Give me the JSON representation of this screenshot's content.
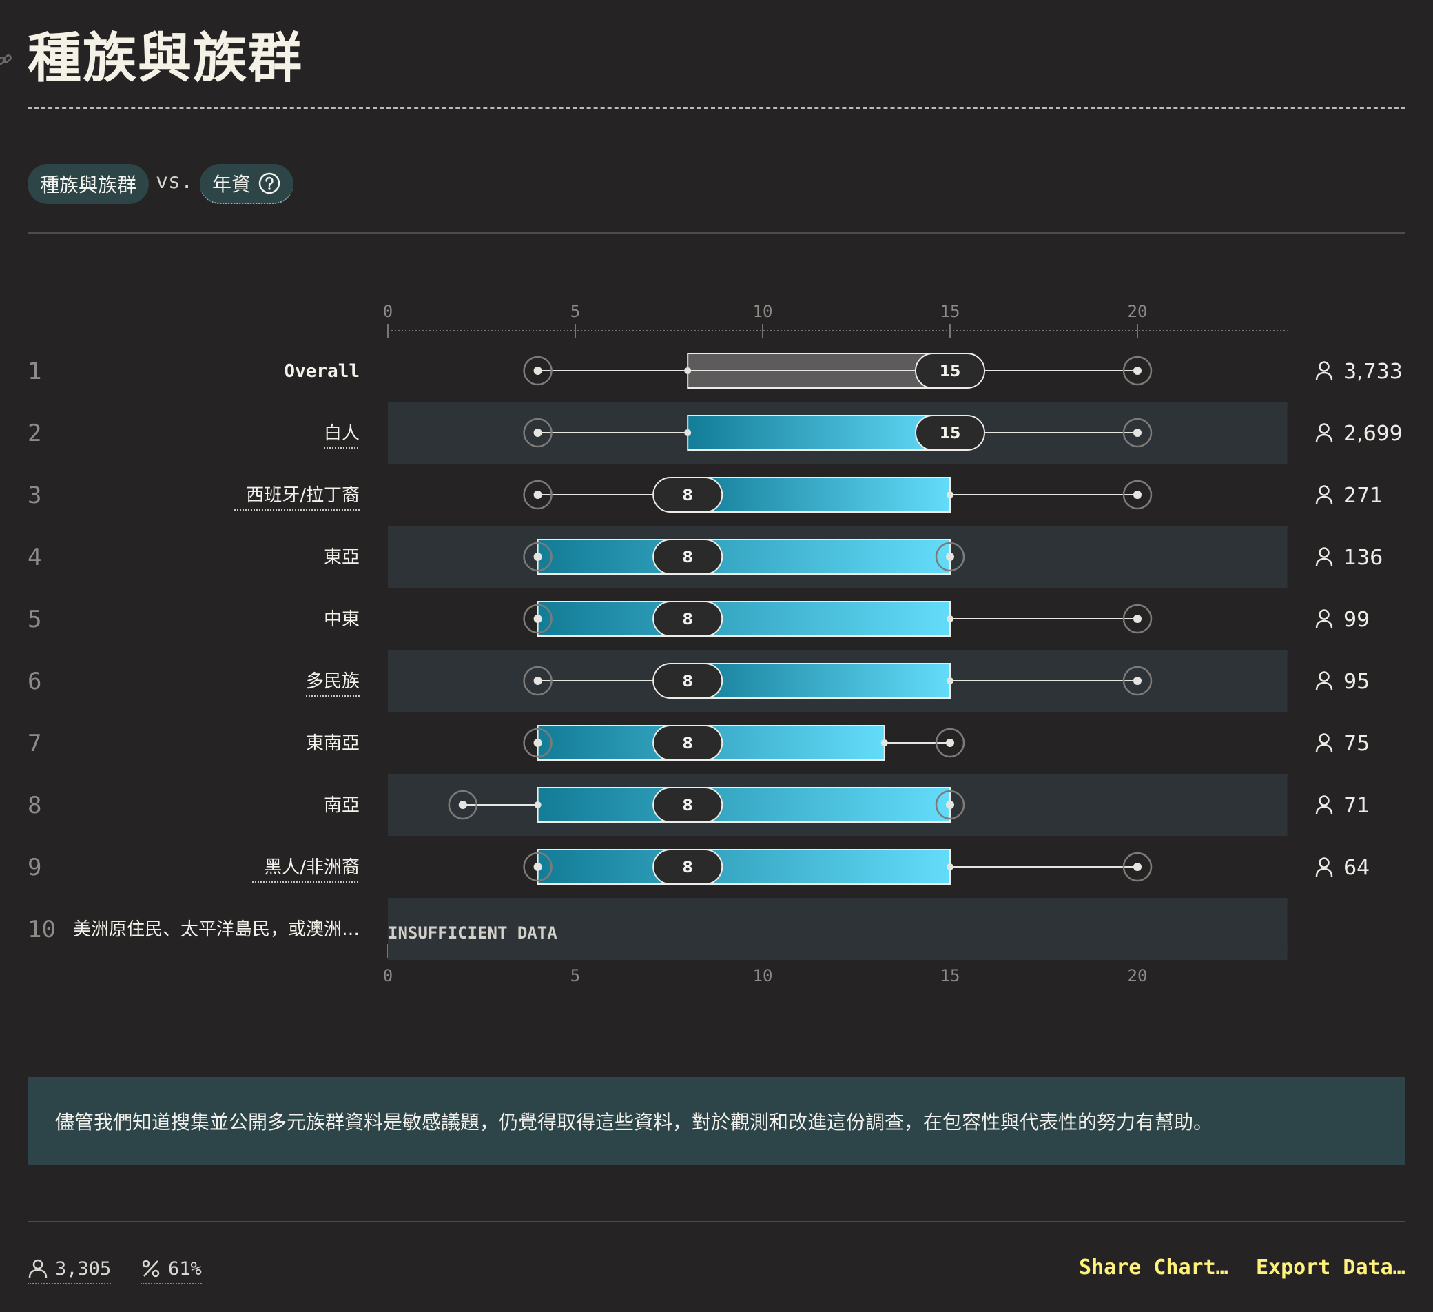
{
  "page": {
    "title": "種族與族群",
    "compare": {
      "primary": "種族與族群",
      "vs": "vs.",
      "secondary": "年資"
    },
    "note": "儘管我們知道搜集並公開多元族群資料是敏感議題，仍覺得取得這些資料，對於觀測和改進這份調查，在包容性與代表性的努力有幫助。",
    "footer": {
      "respondents": "3,305",
      "response_rate": "61%",
      "share_label": "Share Chart…",
      "export_label": "Export Data…"
    }
  },
  "colors": {
    "background": "#252324",
    "band": "#2d3336",
    "bar_start": "#137c97",
    "bar_end": "#63dcfa",
    "overall_bar": "#5d5b5b",
    "accent_link": "#fff27a"
  },
  "chart_data": {
    "type": "boxplot",
    "xlim": [
      0,
      24
    ],
    "ticks": [
      0,
      5,
      10,
      15,
      20
    ],
    "insufficient_label": "INSUFFICIENT DATA",
    "rows": [
      {
        "rank": "1",
        "label": "Overall",
        "count": "3,733",
        "overall": true,
        "min": 4,
        "q1": 8,
        "median": 15,
        "q3": 15,
        "max": 20
      },
      {
        "rank": "2",
        "label": "白人",
        "count": "2,699",
        "underline": true,
        "min": 4,
        "q1": 8,
        "median": 15,
        "q3": 15,
        "max": 20
      },
      {
        "rank": "3",
        "label": "西班牙/拉丁裔",
        "count": "271",
        "underline": true,
        "min": 4,
        "q1": 8,
        "median": 8,
        "q3": 15,
        "max": 20
      },
      {
        "rank": "4",
        "label": "東亞",
        "count": "136",
        "min": 4,
        "q1": 4,
        "median": 8,
        "q3": 15,
        "max": 15
      },
      {
        "rank": "5",
        "label": "中東",
        "count": "99",
        "min": 4,
        "q1": 4,
        "median": 8,
        "q3": 15,
        "max": 20
      },
      {
        "rank": "6",
        "label": "多民族",
        "count": "95",
        "underline": true,
        "min": 4,
        "q1": 8,
        "median": 8,
        "q3": 15,
        "max": 20
      },
      {
        "rank": "7",
        "label": "東南亞",
        "count": "75",
        "min": 4,
        "q1": 4,
        "median": 8,
        "q3": 13.25,
        "max": 15
      },
      {
        "rank": "8",
        "label": "南亞",
        "count": "71",
        "min": 2,
        "q1": 4,
        "median": 8,
        "q3": 15,
        "max": 15
      },
      {
        "rank": "9",
        "label": "黑人/非洲裔",
        "count": "64",
        "underline": true,
        "min": 4,
        "q1": 4,
        "median": 8,
        "q3": 15,
        "max": 20
      },
      {
        "rank": "10",
        "label": "美洲原住民、太平洋島民，或澳洲…",
        "count": "",
        "insufficient": true
      }
    ]
  }
}
